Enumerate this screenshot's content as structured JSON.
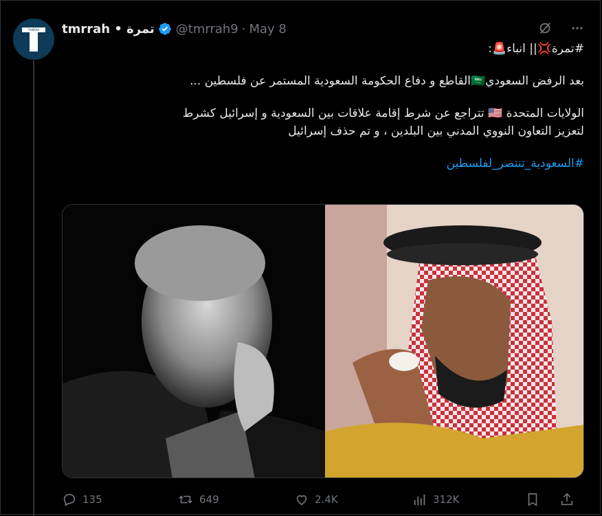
{
  "tweet": {
    "display_name": "tmrrah • تمرة",
    "handle": "@tmrrah9",
    "separator": "·",
    "date": "May 8",
    "line_title": "#تمرة💢|| انباء🚨:",
    "line_1": "بعد الرفض السعودي🇸🇦القاطع و دفاع الحكومة السعودية المستمر عن فلسطين ...",
    "line_2": "الولايات المتحدة 🇺🇸 تتراجع عن شرط إقامة علاقات بين السعودية و إسرائيل كشرط",
    "line_3": "لتعزيز التعاون النووي المدني بين البلدين ، و تم حذف إسرائيل",
    "hashtag": "#السعودية_تنتصر_لفلسطين"
  },
  "avatar_logo_text": "TAMRAH",
  "actions": {
    "replies": "135",
    "reposts": "649",
    "likes": "2.4K",
    "views": "312K"
  },
  "colors": {
    "background": "#000000",
    "text": "#e7e9ea",
    "muted": "#71767b",
    "accent": "#1d9bf0",
    "verified": "#1d9bf0"
  },
  "icons": [
    "verified-badge-icon",
    "grok-icon",
    "more-icon",
    "reply-icon",
    "repost-icon",
    "like-icon",
    "views-icon",
    "bookmark-icon",
    "share-icon"
  ]
}
